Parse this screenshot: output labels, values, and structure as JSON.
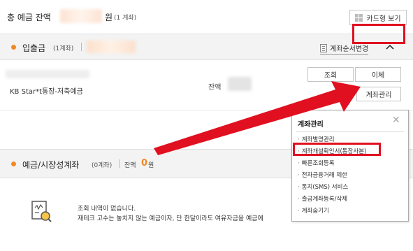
{
  "header": {
    "total_label": "총 예금 잔액",
    "total_unit": "원",
    "total_count": "(1 계좌)",
    "card_view_label": "카드형 보기"
  },
  "deposit_section": {
    "title": "입출금",
    "count": "(1계좌)",
    "order_change_label": "계좌순서변경"
  },
  "account": {
    "name": "KB Star*t통장-저축예금",
    "balance_label": "잔액",
    "inquiry_label": "조회",
    "transfer_label": "이체",
    "manage_label": "계좌관리"
  },
  "popup": {
    "title": "계좌관리",
    "close_symbol": "✕",
    "items": [
      "계좌별명관리",
      "계좌개설확인서(통장사본)",
      "빠른조회등록",
      "전자금융거래 제한",
      "통지(SMS) 서비스",
      "출금계좌등록/삭제",
      "계좌숨기기"
    ]
  },
  "savings_section": {
    "title": "예금/시장성계좌",
    "count": "(0계좌)",
    "balance_label": "잔액",
    "balance_value": "0",
    "balance_unit": "원"
  },
  "empty_state": {
    "line1": "조회 내역이 없습니다.",
    "line2": "재테크 고수는 놓치지 않는 예금이자, 단 한달이라도 여유자금을 예금에"
  },
  "colors": {
    "accent": "#f08a24",
    "highlight_red": "#e01020"
  }
}
